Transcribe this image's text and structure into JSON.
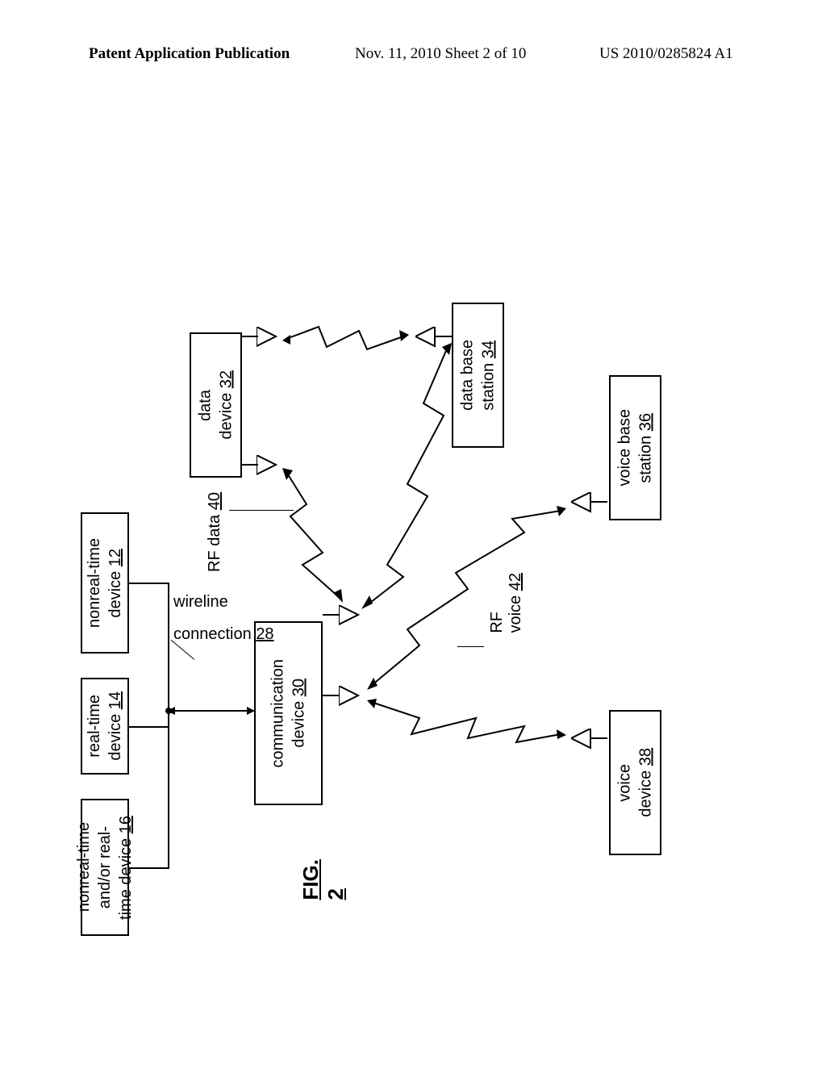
{
  "header": {
    "left": "Patent Application Publication",
    "mid": "Nov. 11, 2010  Sheet 2 of 10",
    "right": "US 2010/0285824 A1"
  },
  "figure_label": "FIG. 2",
  "boxes": {
    "nonreal1": {
      "line1": "nonreal-time",
      "line2": "device",
      "ref": "12"
    },
    "realtime": {
      "line1": "real-time",
      "line2": "device",
      "ref": "14"
    },
    "nonreal2": {
      "line1": "nonreal-time",
      "line2": "and/or real-",
      "line3": "time device",
      "ref": "16"
    },
    "data_device": {
      "line1": "data",
      "line2": "device",
      "ref": "32"
    },
    "data_base": {
      "line1": "data base",
      "line2": "station",
      "ref": "34"
    },
    "comm": {
      "line1": "communication",
      "line2": "device",
      "ref": "30"
    },
    "voice_base": {
      "line1": "voice base",
      "line2": "station",
      "ref": "36"
    },
    "voice_device": {
      "line1": "voice",
      "line2": "device",
      "ref": "38"
    }
  },
  "labels": {
    "wireline1": "wireline",
    "wireline2_word": "connection",
    "wireline2_ref": "28",
    "rf_data_word": "RF data",
    "rf_data_ref": "40",
    "rf_voice_line1": "RF",
    "rf_voice_word": "voice",
    "rf_voice_ref": "42"
  }
}
